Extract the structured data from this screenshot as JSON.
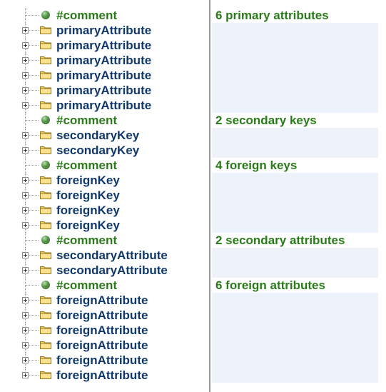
{
  "tree": {
    "rows": [
      {
        "kind": "comment",
        "label": "#comment"
      },
      {
        "kind": "folder",
        "label": "primaryAttribute"
      },
      {
        "kind": "folder",
        "label": "primaryAttribute"
      },
      {
        "kind": "folder",
        "label": "primaryAttribute"
      },
      {
        "kind": "folder",
        "label": "primaryAttribute"
      },
      {
        "kind": "folder",
        "label": "primaryAttribute"
      },
      {
        "kind": "folder",
        "label": "primaryAttribute"
      },
      {
        "kind": "comment",
        "label": "#comment"
      },
      {
        "kind": "folder",
        "label": "secondaryKey"
      },
      {
        "kind": "folder",
        "label": "secondaryKey"
      },
      {
        "kind": "comment",
        "label": "#comment"
      },
      {
        "kind": "folder",
        "label": "foreignKey"
      },
      {
        "kind": "folder",
        "label": "foreignKey"
      },
      {
        "kind": "folder",
        "label": "foreignKey"
      },
      {
        "kind": "folder",
        "label": "foreignKey"
      },
      {
        "kind": "comment",
        "label": "#comment"
      },
      {
        "kind": "folder",
        "label": "secondaryAttribute"
      },
      {
        "kind": "folder",
        "label": "secondaryAttribute"
      },
      {
        "kind": "comment",
        "label": "#comment"
      },
      {
        "kind": "folder",
        "label": "foreignAttribute"
      },
      {
        "kind": "folder",
        "label": "foreignAttribute"
      },
      {
        "kind": "folder",
        "label": "foreignAttribute"
      },
      {
        "kind": "folder",
        "label": "foreignAttribute"
      },
      {
        "kind": "folder",
        "label": "foreignAttribute"
      },
      {
        "kind": "folder",
        "label": "foreignAttribute"
      }
    ]
  },
  "panel": {
    "comments": [
      {
        "text": "6 primary attributes",
        "span": 6
      },
      {
        "text": "2 secondary keys",
        "span": 2
      },
      {
        "text": "4 foreign keys",
        "span": 4
      },
      {
        "text": "2 secondary attributes",
        "span": 2
      },
      {
        "text": "6 foreign attributes",
        "span": 6
      }
    ]
  },
  "icons": {
    "folder": "folder-icon",
    "comment": "comment-node-icon",
    "expander": "plus-expander-icon"
  },
  "colors": {
    "folder_label": "#10386b",
    "comment_label": "#2a7a1a",
    "panel_fill": "#eef3fb"
  }
}
